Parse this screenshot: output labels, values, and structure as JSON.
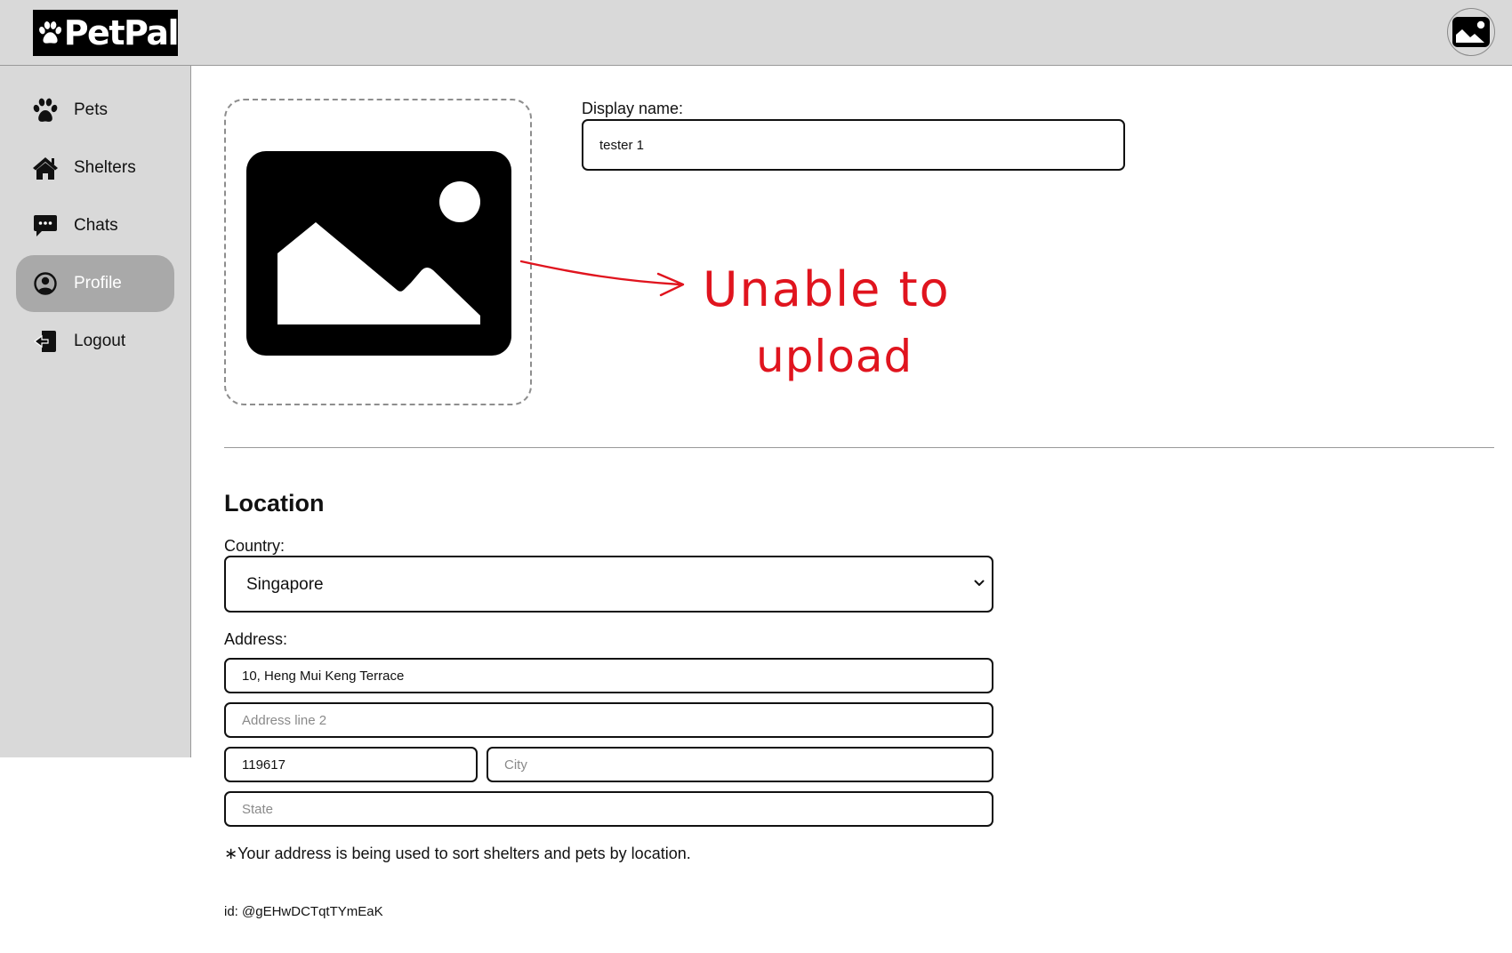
{
  "header": {
    "logo_text": "PetPal",
    "logo_icon": "paw-icon",
    "avatar_icon": "image-placeholder-icon"
  },
  "sidebar": {
    "items": [
      {
        "label": "Pets",
        "icon": "paw-icon",
        "active": false
      },
      {
        "label": "Shelters",
        "icon": "house-icon",
        "active": false
      },
      {
        "label": "Chats",
        "icon": "chat-bubble-icon",
        "active": false
      },
      {
        "label": "Profile",
        "icon": "user-circle-icon",
        "active": true
      },
      {
        "label": "Logout",
        "icon": "logout-icon",
        "active": false
      }
    ]
  },
  "profile": {
    "photo_icon": "image-placeholder-icon",
    "display_name_label": "Display name:",
    "display_name_value": "tester 1"
  },
  "annotation": {
    "line1": "Unable  to",
    "line2": "upload",
    "color": "#e0141e"
  },
  "location": {
    "title": "Location",
    "country_label": "Country:",
    "country_value": "Singapore",
    "address_label": "Address:",
    "address_line1_value": "10, Heng Mui Keng Terrace",
    "address_line2_placeholder": "Address line 2",
    "postal_code_value": "119617",
    "city_placeholder": "City",
    "state_placeholder": "State",
    "note": "∗Your address is being used to sort shelters and pets by location."
  },
  "footer": {
    "user_id": "id: @gEHwDCTqtTYmEaK"
  },
  "colors": {
    "header_bg": "#d9d9d9",
    "sidebar_bg": "#d9d9d9",
    "active_nav_bg": "#a9a9a9",
    "annotation_red": "#e0141e"
  }
}
